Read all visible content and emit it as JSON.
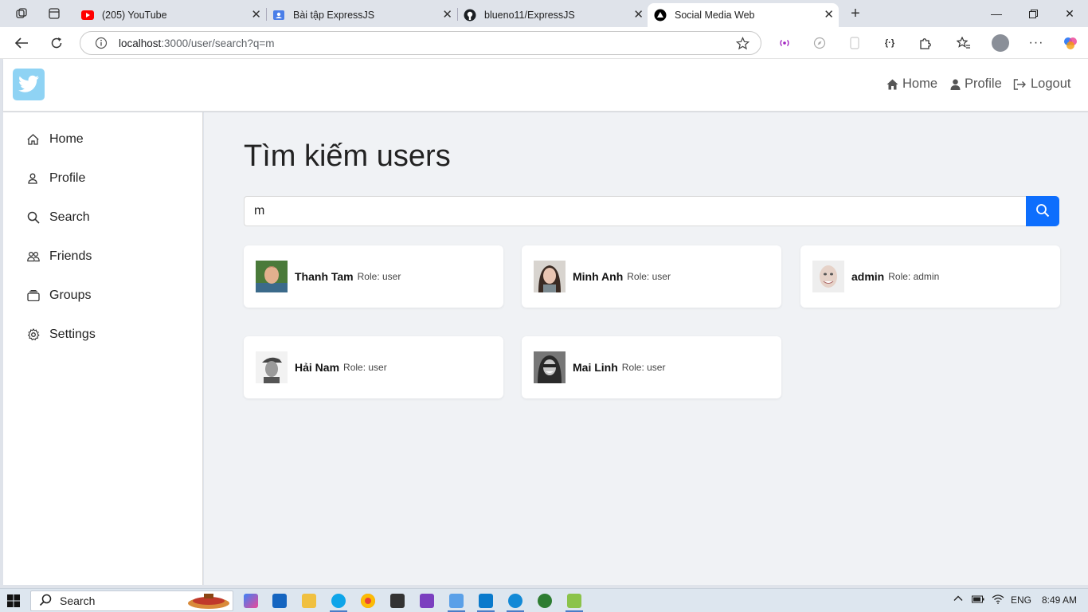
{
  "browser": {
    "tabs": [
      {
        "title": "(205) YouTube",
        "icon": "youtube-icon",
        "active": false
      },
      {
        "title": "Bài tập ExpressJS",
        "icon": "contact-card-icon",
        "active": false
      },
      {
        "title": "blueno11/ExpressJS",
        "icon": "github-icon",
        "active": false
      },
      {
        "title": "Social Media Web",
        "icon": "triangle-logo-icon",
        "active": true
      }
    ],
    "url_host": "localhost",
    "url_path": ":3000/user/search?q=m"
  },
  "header": {
    "logo_icon": "twitter-bird-icon",
    "nav": [
      {
        "label": "Home",
        "icon": "home-icon"
      },
      {
        "label": "Profile",
        "icon": "user-icon"
      },
      {
        "label": "Logout",
        "icon": "logout-icon"
      }
    ]
  },
  "sidebar": {
    "items": [
      {
        "label": "Home",
        "icon": "home-outline-icon"
      },
      {
        "label": "Profile",
        "icon": "person-outline-icon"
      },
      {
        "label": "Search",
        "icon": "search-icon"
      },
      {
        "label": "Friends",
        "icon": "people-icon"
      },
      {
        "label": "Groups",
        "icon": "folder-stack-icon"
      },
      {
        "label": "Settings",
        "icon": "gear-icon"
      }
    ]
  },
  "main": {
    "title": "Tìm kiếm users",
    "search_value": "m",
    "search_button_icon": "search-icon",
    "accent_color": "#0d6efd",
    "users": [
      {
        "name": "Thanh Tam",
        "role": "Role: user",
        "avatar": "avatar-photo"
      },
      {
        "name": "Minh Anh",
        "role": "Role: user",
        "avatar": "avatar-photo"
      },
      {
        "name": "admin",
        "role": "Role: admin",
        "avatar": "avatar-photo"
      },
      {
        "name": "Hải Nam",
        "role": "Role: user",
        "avatar": "avatar-photo"
      },
      {
        "name": "Mai Linh",
        "role": "Role: user",
        "avatar": "avatar-photo"
      }
    ]
  },
  "taskbar": {
    "search_label": "Search",
    "language": "ENG",
    "time": "8:49 AM"
  }
}
